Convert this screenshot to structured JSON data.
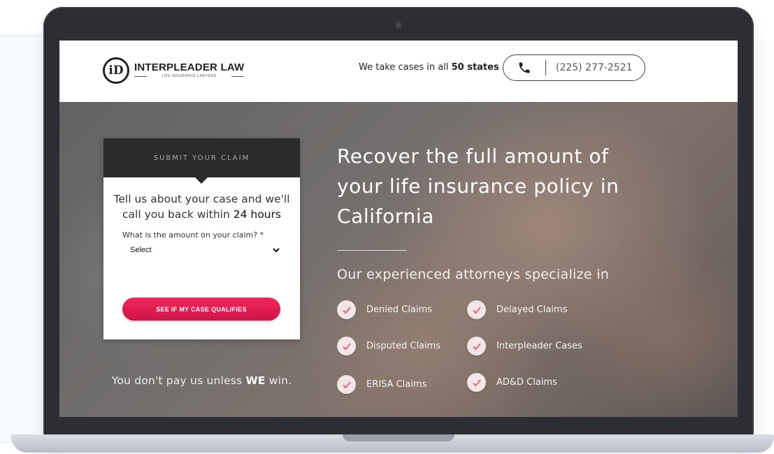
{
  "header": {
    "logo_mark": "iD",
    "logo_name": "INTERPLEADER LAW",
    "logo_sub": "LIFE INSURANCE LAWYERS",
    "states_prefix": "We take cases in all",
    "states_bold": "50 states",
    "phone": "(225) 277-2521",
    "phone_icon": "phone-icon"
  },
  "form": {
    "heading": "SUBMIT YOUR CLAIM",
    "intro_text": "Tell us about your case and we'll call you back within",
    "intro_bold": "24 hours",
    "field_label": "What is the amount on your claim? *",
    "select_value": "Select",
    "cta_label": "SEE IF MY CASE QUALIFIES"
  },
  "guarantee": {
    "prefix": "You don't pay us unless",
    "bold": "WE",
    "suffix": "win."
  },
  "hero": {
    "headline": "Recover the full amount of your life insurance policy in California",
    "subhead": "Our experienced attorneys specialize in",
    "features": [
      "Denied Claims",
      "Delayed Claims",
      "Disputed Claims",
      "Interpleader Cases",
      "ERISA Claims",
      "AD&D Claims"
    ]
  },
  "colors": {
    "cta": "#e31b50",
    "header_bg": "#ffffff",
    "card_head": "#2b2b2b",
    "bezel": "#2c2e33"
  }
}
